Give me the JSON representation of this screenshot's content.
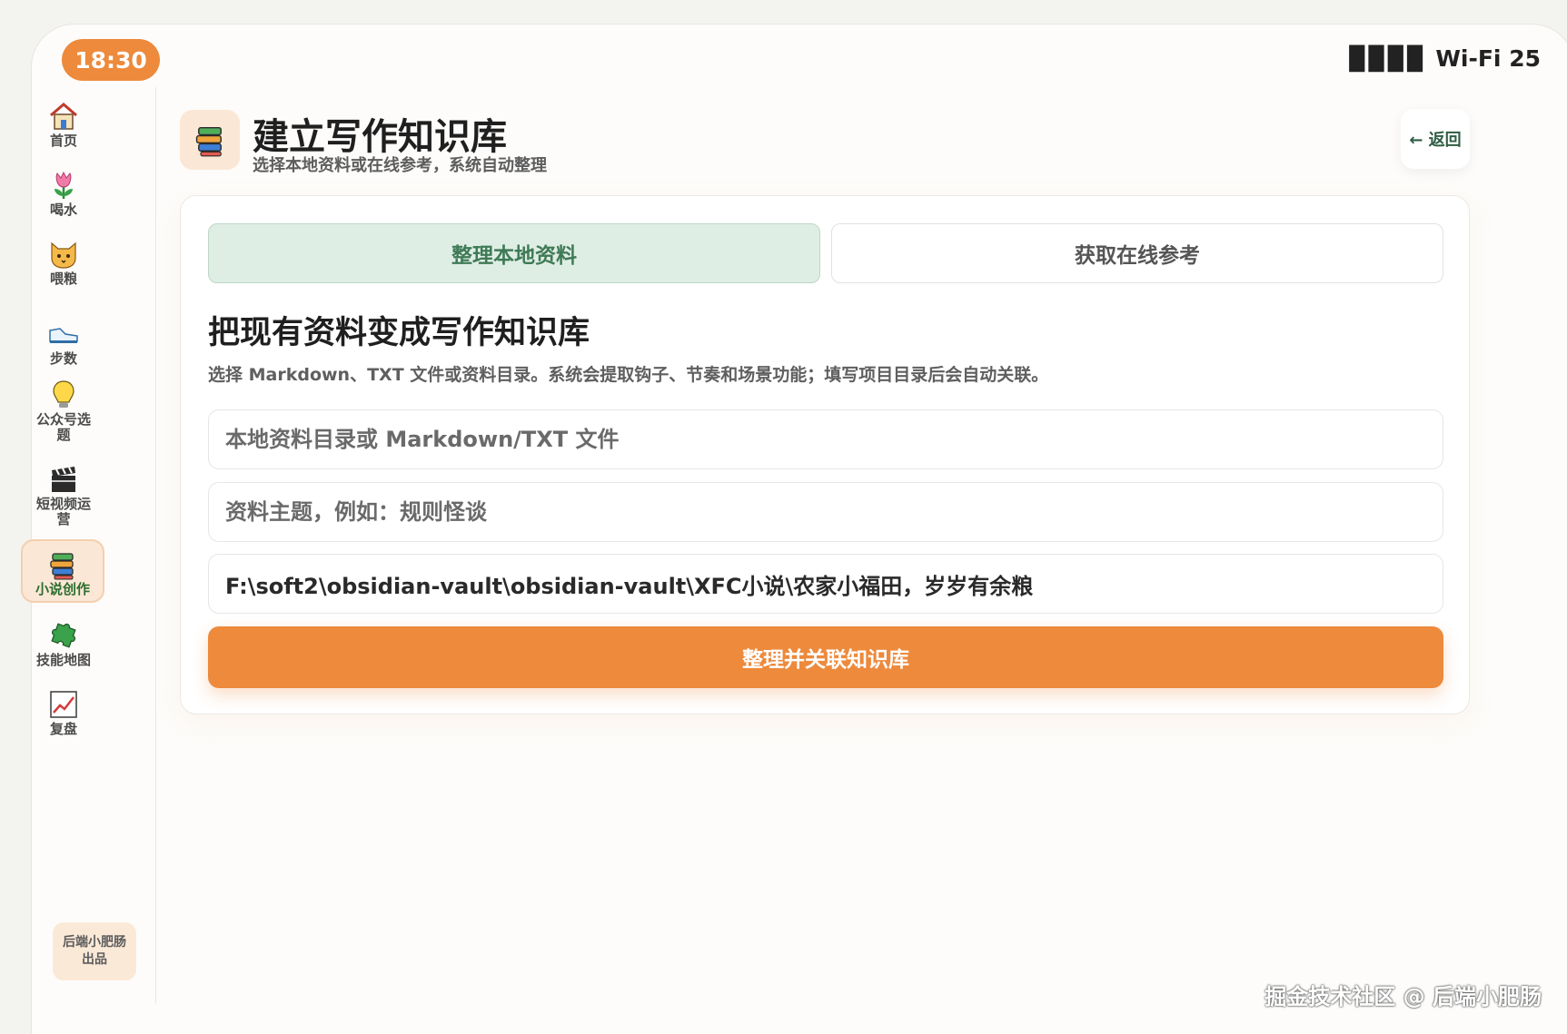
{
  "status_bar": {
    "time": "18:30",
    "signal_bars": "▉▉▉▉",
    "network": "Wi-Fi 25"
  },
  "sidebar": {
    "items": [
      {
        "label": "首页",
        "icon": "house-icon"
      },
      {
        "label": "喝水",
        "icon": "tulip-icon"
      },
      {
        "label": "喂粮",
        "icon": "cat-icon"
      },
      {
        "label": "步数",
        "icon": "sneaker-icon"
      },
      {
        "label": "公众号选题",
        "icon": "lightbulb-icon"
      },
      {
        "label": "短视频运营",
        "icon": "clapperboard-icon"
      },
      {
        "label": "小说创作",
        "icon": "books-icon",
        "active": true
      },
      {
        "label": "技能地图",
        "icon": "puzzle-icon"
      },
      {
        "label": "复盘",
        "icon": "chart-icon"
      }
    ],
    "credit": "后端小肥肠出品"
  },
  "header": {
    "title": "建立写作知识库",
    "subtitle": "选择本地资料或在线参考，系统自动整理",
    "back_label": "← 返回"
  },
  "tabs": [
    {
      "label": "整理本地资料",
      "active": true
    },
    {
      "label": "获取在线参考",
      "active": false
    }
  ],
  "form": {
    "heading": "把现有资料变成写作知识库",
    "description": "选择 Markdown、TXT 文件或资料目录。系统会提取钩子、节奏和场景功能；填写项目目录后会自动关联。",
    "source_path": {
      "placeholder": "本地资料目录或 Markdown/TXT 文件",
      "value": ""
    },
    "topic": {
      "placeholder": "资料主题，例如：规则怪谈",
      "value": ""
    },
    "project_path": {
      "placeholder": "",
      "value": "F:\\soft2\\obsidian-vault\\obsidian-vault\\XFC小说\\农家小福田，岁岁有余粮"
    },
    "submit_label": "整理并关联知识库"
  },
  "watermark": "掘金技术社区 @ 后端小肥肠",
  "colors": {
    "accent": "#ed8a3c",
    "active_tab_bg": "#dfeee4",
    "active_tab_text": "#3f7a57"
  }
}
